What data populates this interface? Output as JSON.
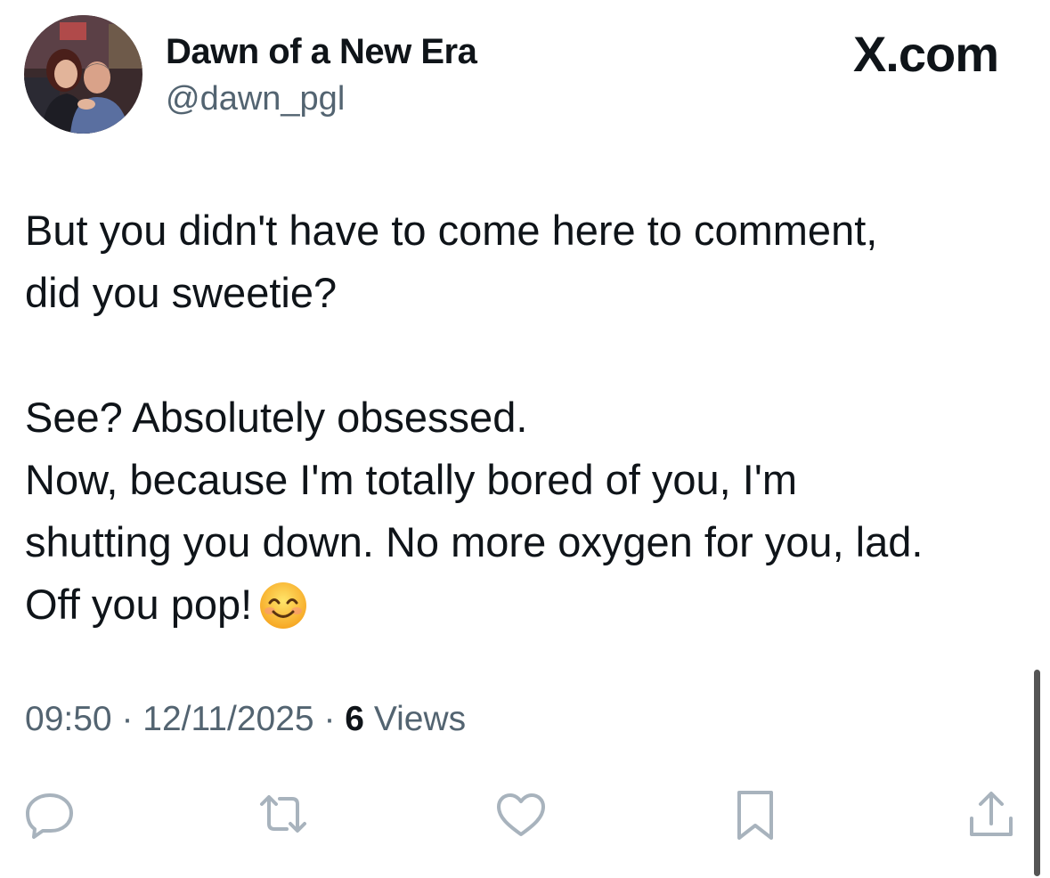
{
  "author": {
    "display_name": "Dawn of a New Era",
    "handle": "@dawn_pgl",
    "avatar": "profile-photo-two-people"
  },
  "brand": {
    "logo_text": "X.com"
  },
  "tweet": {
    "lines": [
      "But you didn't have to come here to comment,",
      "did you sweetie?",
      "",
      "See? Absolutely obsessed.",
      "Now, because I'm totally bored of you, I'm",
      "shutting you down. No more oxygen for you, lad.",
      "Off you pop!"
    ],
    "emoji": "smiling-face-with-smiling-eyes"
  },
  "meta": {
    "time": "09:50",
    "separator": "·",
    "date": "12/11/2025",
    "views_count": "6",
    "views_label": "Views"
  },
  "actions": [
    {
      "name": "reply",
      "icon": "reply-icon"
    },
    {
      "name": "repost",
      "icon": "repost-icon"
    },
    {
      "name": "like",
      "icon": "like-icon"
    },
    {
      "name": "bookmark",
      "icon": "bookmark-icon"
    },
    {
      "name": "share",
      "icon": "share-icon"
    }
  ],
  "colors": {
    "text_primary": "#0f1419",
    "text_secondary": "#536471",
    "icon_gray": "#a8b3bd",
    "background": "#ffffff"
  }
}
